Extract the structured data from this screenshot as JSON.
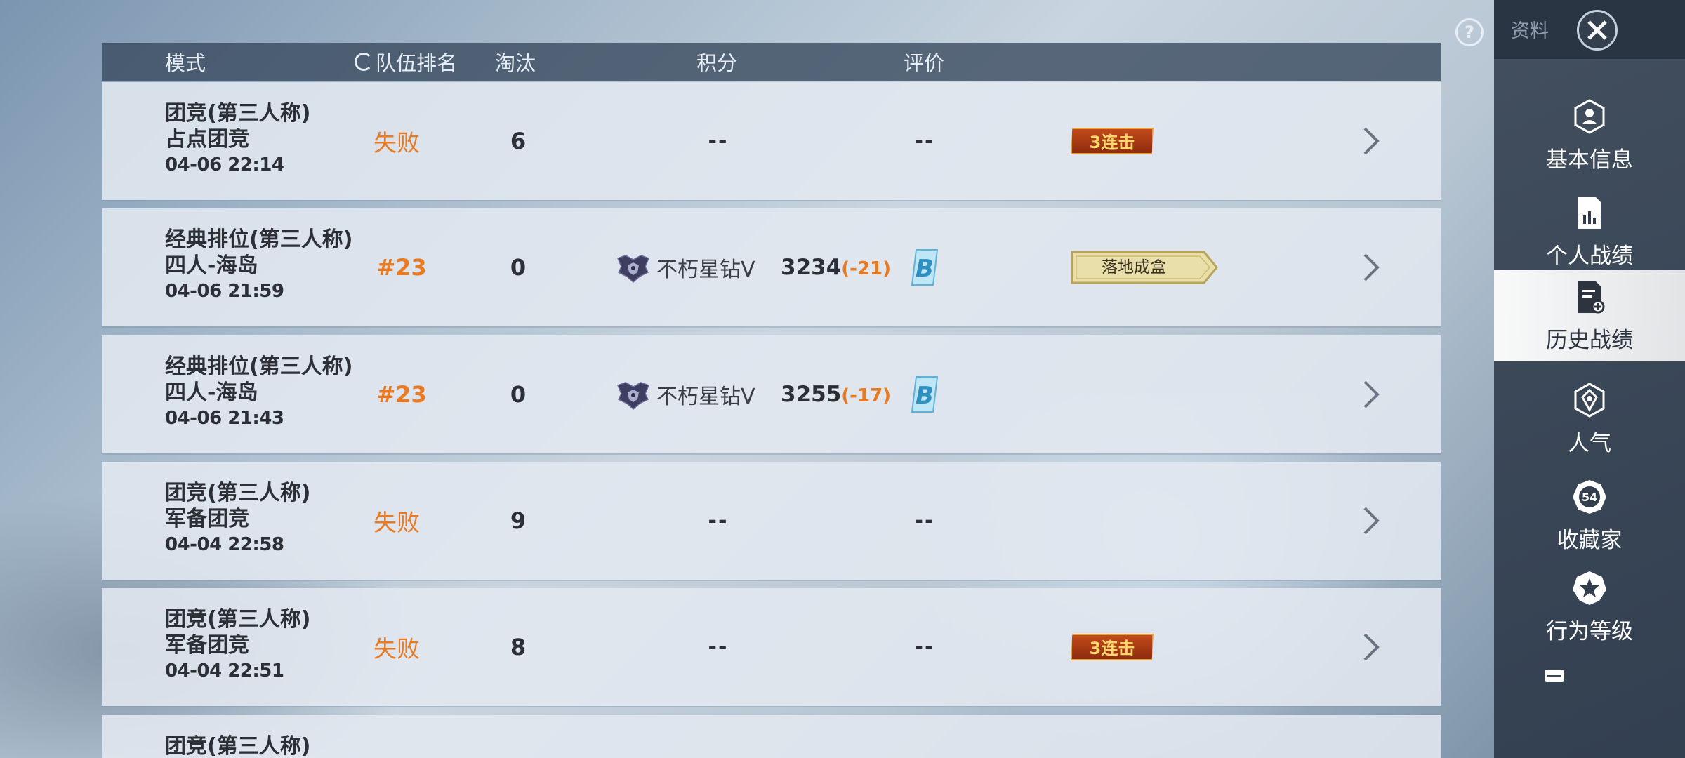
{
  "header": {
    "mode": "模式",
    "team_rank": "队伍排名",
    "kills": "淘汰",
    "score": "积分",
    "rating": "评价"
  },
  "rows": [
    {
      "mode": "团竞(第三人称)",
      "map": "占点团竞",
      "time": "04-06 22:14",
      "rank": "失败",
      "kills": "6",
      "score": "--",
      "rating": "--",
      "badge": "3连击"
    },
    {
      "mode": "经典排位(第三人称)",
      "map": "四人-海岛",
      "time": "04-06 21:59",
      "rank": "#23",
      "kills": "0",
      "tier": "不朽星钻Ⅴ",
      "points": "3234",
      "delta": "(-21)",
      "grade": "B",
      "badge": "落地成盒"
    },
    {
      "mode": "经典排位(第三人称)",
      "map": "四人-海岛",
      "time": "04-06 21:43",
      "rank": "#23",
      "kills": "0",
      "tier": "不朽星钻Ⅴ",
      "points": "3255",
      "delta": "(-17)",
      "grade": "B"
    },
    {
      "mode": "团竞(第三人称)",
      "map": "军备团竞",
      "time": "04-04 22:58",
      "rank": "失败",
      "kills": "9",
      "score": "--",
      "rating": "--"
    },
    {
      "mode": "团竞(第三人称)",
      "map": "军备团竞",
      "time": "04-04 22:51",
      "rank": "失败",
      "kills": "8",
      "score": "--",
      "rating": "--",
      "badge": "3连击"
    },
    {
      "mode": "团竞(第三人称)"
    }
  ],
  "sidebar": {
    "title": "资料",
    "help": "?",
    "items": [
      {
        "label": "基本信息",
        "icon": "user-shield-icon"
      },
      {
        "label": "个人战绩",
        "icon": "stats-doc-icon"
      },
      {
        "label": "历史战绩",
        "icon": "history-doc-icon",
        "active": true
      },
      {
        "label": "人气",
        "icon": "popularity-icon"
      },
      {
        "label": "收藏家",
        "icon": "collector-icon",
        "level": "54"
      },
      {
        "label": "行为等级",
        "icon": "behavior-badge-icon"
      }
    ]
  },
  "colors": {
    "accent_orange": "#e97a22",
    "row_bg": "#e2e8f0",
    "header_bg": "#37485c",
    "sidebar_bg": "#323e4e"
  }
}
